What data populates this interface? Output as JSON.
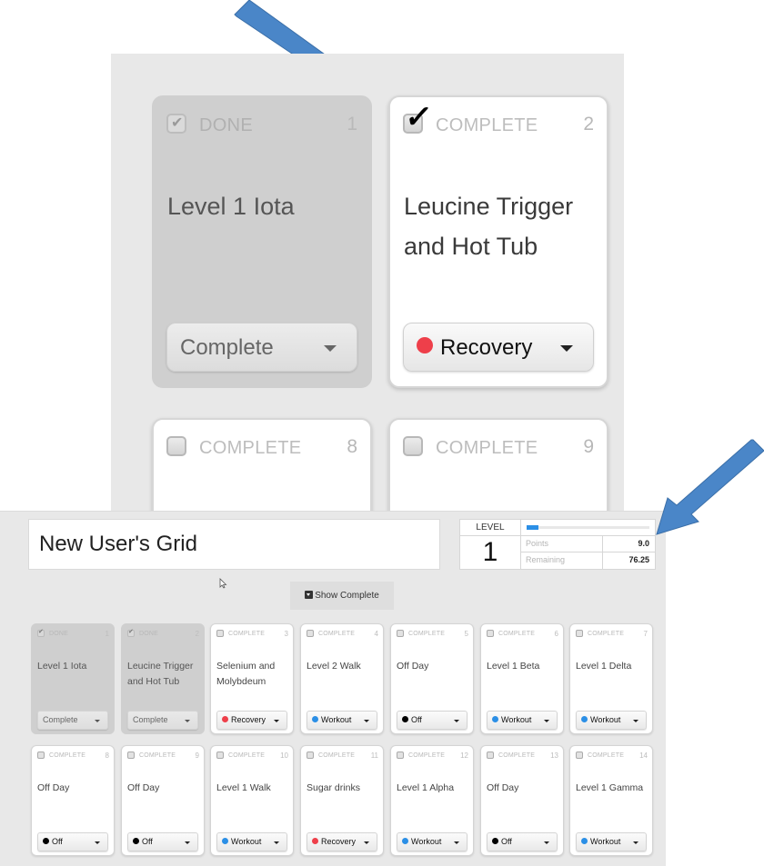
{
  "callout": {
    "cards": [
      {
        "number": "1",
        "status": "DONE",
        "title_lines": [
          "Level 1 Iota"
        ],
        "select_label": "Complete",
        "dot_color": null,
        "done": true,
        "checked": true
      },
      {
        "number": "2",
        "status": "COMPLETE",
        "title_lines": [
          "Leucine Trigger",
          "and Hot Tub"
        ],
        "select_label": "Recovery",
        "dot_color": "#ee3f4a",
        "done": false,
        "checked": true
      },
      {
        "number": "8",
        "status": "COMPLETE",
        "title_lines": [],
        "select_label": null,
        "dot_color": null,
        "done": false,
        "checked": false
      },
      {
        "number": "9",
        "status": "COMPLETE",
        "title_lines": [],
        "select_label": null,
        "dot_color": null,
        "done": false,
        "checked": false
      }
    ]
  },
  "app": {
    "grid_title": "New User's Grid",
    "level": {
      "label": "LEVEL",
      "value": "1",
      "progress_percent": 9.5,
      "points_label": "Points",
      "points_value": "9.0",
      "remaining_label": "Remaining",
      "remaining_value": "76.25"
    },
    "show_complete_label": "Show Complete",
    "colors": {
      "recovery": "#ee3f4a",
      "workout": "#2b8fe6",
      "off": "#000000",
      "arrow": "#4a86c8"
    },
    "cards": [
      {
        "number": "1",
        "status": "DONE",
        "title": "Level 1 Iota",
        "select": "Complete",
        "type": null,
        "done": true
      },
      {
        "number": "2",
        "status": "DONE",
        "title": "Leucine Trigger and Hot Tub",
        "select": "Complete",
        "type": null,
        "done": true
      },
      {
        "number": "3",
        "status": "COMPLETE",
        "title": "Selenium and Molybdeum",
        "select": "Recovery",
        "type": "recovery",
        "done": false
      },
      {
        "number": "4",
        "status": "COMPLETE",
        "title": "Level 2 Walk",
        "select": "Workout",
        "type": "workout",
        "done": false
      },
      {
        "number": "5",
        "status": "COMPLETE",
        "title": "Off Day",
        "select": "Off",
        "type": "off",
        "done": false
      },
      {
        "number": "6",
        "status": "COMPLETE",
        "title": "Level 1 Beta",
        "select": "Workout",
        "type": "workout",
        "done": false
      },
      {
        "number": "7",
        "status": "COMPLETE",
        "title": "Level 1 Delta",
        "select": "Workout",
        "type": "workout",
        "done": false
      },
      {
        "number": "8",
        "status": "COMPLETE",
        "title": "Off Day",
        "select": "Off",
        "type": "off",
        "done": false
      },
      {
        "number": "9",
        "status": "COMPLETE",
        "title": "Off Day",
        "select": "Off",
        "type": "off",
        "done": false
      },
      {
        "number": "10",
        "status": "COMPLETE",
        "title": "Level 1 Walk",
        "select": "Workout",
        "type": "workout",
        "done": false
      },
      {
        "number": "11",
        "status": "COMPLETE",
        "title": "Sugar drinks",
        "select": "Recovery",
        "type": "recovery",
        "done": false
      },
      {
        "number": "12",
        "status": "COMPLETE",
        "title": "Level 1 Alpha",
        "select": "Workout",
        "type": "workout",
        "done": false
      },
      {
        "number": "13",
        "status": "COMPLETE",
        "title": "Off Day",
        "select": "Off",
        "type": "off",
        "done": false
      },
      {
        "number": "14",
        "status": "COMPLETE",
        "title": "Level 1 Gamma",
        "select": "Workout",
        "type": "workout",
        "done": false
      }
    ]
  }
}
